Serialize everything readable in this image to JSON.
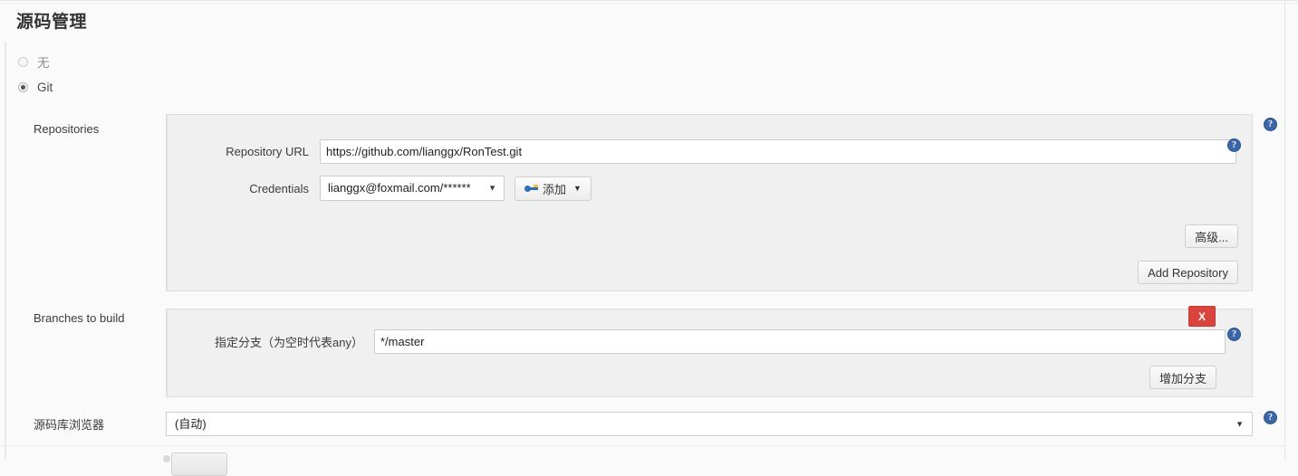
{
  "section": {
    "title": "源码管理"
  },
  "scm_options": [
    {
      "label": "无",
      "selected": false,
      "name": "scm-none"
    },
    {
      "label": "Git",
      "selected": true,
      "name": "scm-git"
    }
  ],
  "repositories": {
    "row_label": "Repositories",
    "url": {
      "label": "Repository URL",
      "value": "https://github.com/lianggx/RonTest.git",
      "placeholder": ""
    },
    "credentials": {
      "label": "Credentials",
      "selected": "lianggx@foxmail.com/******",
      "add_button": "添加",
      "add_icon": "key-icon",
      "caret": "▼"
    },
    "advanced_button": "高级...",
    "add_repository_button": "Add Repository"
  },
  "branches": {
    "row_label": "Branches to build",
    "branch_spec": {
      "label": "指定分支（为空时代表any）",
      "value": "*/master",
      "placeholder": ""
    },
    "delete_button": "X",
    "add_branch_button": "增加分支"
  },
  "source_browser": {
    "row_label": "源码库浏览器",
    "selected": "(自动)",
    "caret": "▼"
  },
  "help_icons": {
    "repositories": "?",
    "repository_url": "?",
    "branch_spec": "?",
    "source_browser": "?"
  },
  "colors": {
    "page_bg": "#fafafa",
    "panel_bg": "#f0f0f0",
    "panel_border": "#dedede",
    "help_blue": "#3b66a8",
    "delete_red": "#d9453d",
    "key_blue": "#2d6fb8",
    "key_yellow": "#f2c437"
  }
}
